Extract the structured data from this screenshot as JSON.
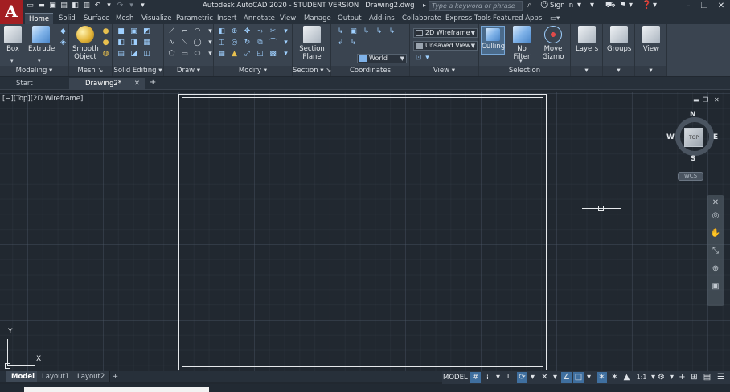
{
  "app": {
    "logo_letter": "A",
    "title": "Autodesk AutoCAD 2020 - STUDENT VERSION",
    "file": "Drawing2.dwg"
  },
  "header": {
    "search_placeholder": "Type a keyword or phrase",
    "sign_in": "Sign In"
  },
  "ribbon_tabs": [
    "Home",
    "Solid",
    "Surface",
    "Mesh",
    "Visualize",
    "Parametric",
    "Insert",
    "Annotate",
    "View",
    "Manage",
    "Output",
    "Add-ins",
    "Collaborate",
    "Express Tools",
    "Featured Apps"
  ],
  "panels": {
    "modeling": {
      "title": "Modeling",
      "box": "Box",
      "extrude": "Extrude"
    },
    "mesh": {
      "title": "Mesh",
      "smooth_1": "Smooth",
      "smooth_2": "Object"
    },
    "solid_editing": {
      "title": "Solid Editing"
    },
    "draw": {
      "title": "Draw"
    },
    "modify": {
      "title": "Modify"
    },
    "section": {
      "title": "Section",
      "section_1": "Section",
      "section_2": "Plane"
    },
    "coordinates": {
      "title": "Coordinates",
      "world": "World"
    },
    "view": {
      "title": "View",
      "visual_style": "2D Wireframe",
      "saved_view": "Unsaved View"
    },
    "selection": {
      "title": "Selection",
      "culling": "Culling",
      "no_filter": "No Filter",
      "move_1": "Move",
      "move_2": "Gizmo"
    },
    "layers": {
      "title": "Layers"
    },
    "groups": {
      "title": "Groups"
    },
    "view2": {
      "title": "View"
    }
  },
  "file_tabs": {
    "start": "Start",
    "drawing": "Drawing2*"
  },
  "viewport": {
    "label": "[−][Top][2D Wireframe]",
    "compass": {
      "n": "N",
      "s": "S",
      "e": "E",
      "w": "W",
      "cube": "TOP"
    },
    "wcs": "WCS",
    "ucs_x": "X",
    "ucs_y": "Y"
  },
  "layout_tabs": [
    "Model",
    "Layout1",
    "Layout2"
  ],
  "status": {
    "model": "MODEL",
    "scale": "1:1"
  }
}
